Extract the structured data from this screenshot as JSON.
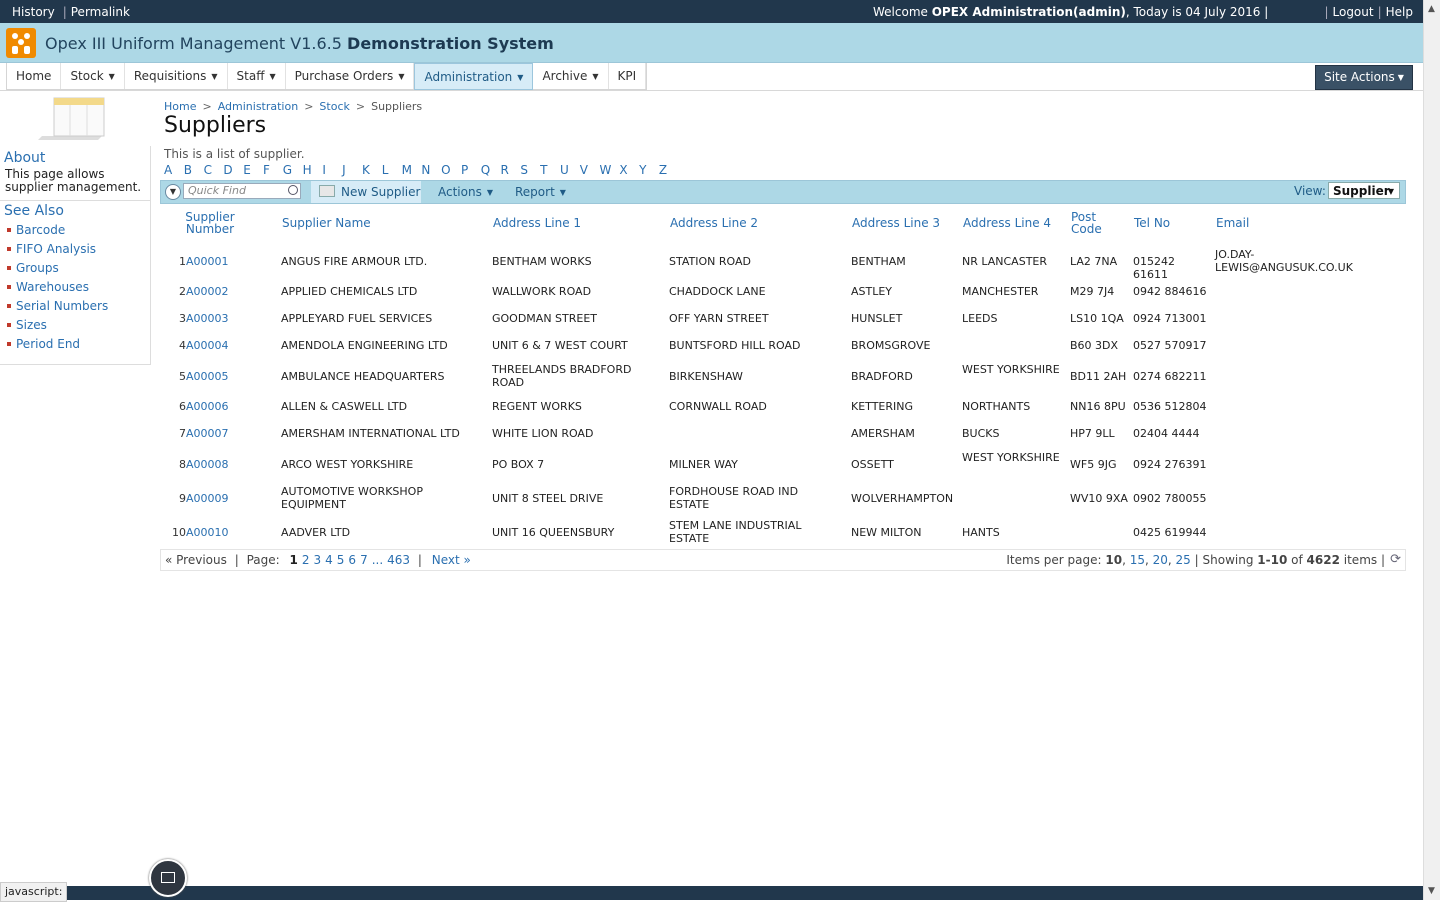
{
  "topbar": {
    "history": "History",
    "permalink": "Permalink",
    "welcome_prefix": "Welcome",
    "user": "OPEX Administration(admin)",
    "today": ", Today is 04 July 2016 |",
    "logout": "Logout",
    "help": "Help"
  },
  "site": {
    "title": "Opex III Uniform Management V1.6.5",
    "subtitle": "Demonstration System"
  },
  "nav": {
    "items": [
      "Home",
      "Stock",
      "Requisitions",
      "Staff",
      "Purchase Orders",
      "Administration",
      "Archive",
      "KPI"
    ],
    "site_actions": "Site Actions"
  },
  "left": {
    "about_title": "About",
    "about_text": "This page allows supplier management.",
    "see_also_title": "See Also",
    "links": [
      "Barcode",
      "FIFO Analysis",
      "Groups",
      "Warehouses",
      "Serial Numbers",
      "Sizes",
      "Period End"
    ]
  },
  "breadcrumb": [
    "Home",
    "Administration",
    "Stock",
    "Suppliers"
  ],
  "page": {
    "title": "Suppliers",
    "description": "This is a list of supplier."
  },
  "alphabet": [
    "A",
    "B",
    "C",
    "D",
    "E",
    "F",
    "G",
    "H",
    "I",
    "J",
    "K",
    "L",
    "M",
    "N",
    "O",
    "P",
    "Q",
    "R",
    "S",
    "T",
    "U",
    "V",
    "W",
    "X",
    "Y",
    "Z"
  ],
  "toolbar": {
    "quick_find_placeholder": "Quick Find",
    "new_supplier": "New Supplier",
    "actions": "Actions",
    "report": "Report",
    "view_label": "View:",
    "view_value": "Supplier"
  },
  "table": {
    "headers": [
      "Supplier Number",
      "Supplier Name",
      "Address Line 1",
      "Address Line 2",
      "Address Line 3",
      "Address Line 4",
      "Post Code",
      "Tel No",
      "Email"
    ],
    "rows": [
      [
        "1",
        "A00001",
        "ANGUS FIRE ARMOUR LTD.",
        "BENTHAM WORKS",
        "STATION ROAD",
        "BENTHAM",
        "NR LANCASTER",
        "LA2 7NA",
        "015242 61611",
        "JO.DAY-LEWIS@ANGUSUK.CO.UK"
      ],
      [
        "2",
        "A00002",
        "APPLIED CHEMICALS LTD",
        "WALLWORK ROAD",
        "CHADDOCK LANE",
        "ASTLEY",
        "MANCHESTER",
        "M29 7J4",
        "0942 884616",
        ""
      ],
      [
        "3",
        "A00003",
        "APPLEYARD FUEL SERVICES",
        "GOODMAN STREET",
        "OFF YARN STREET",
        "HUNSLET",
        "LEEDS",
        "LS10 1QA",
        "0924 713001",
        ""
      ],
      [
        "4",
        "A00004",
        "AMENDOLA ENGINEERING LTD",
        "UNIT 6 & 7 WEST COURT",
        "BUNTSFORD HILL ROAD",
        "BROMSGROVE",
        "",
        "B60 3DX",
        "0527 570917",
        ""
      ],
      [
        "5",
        "A00005",
        "AMBULANCE HEADQUARTERS",
        "THREELANDS BRADFORD ROAD",
        "BIRKENSHAW",
        "BRADFORD",
        "WEST YORKSHIRE",
        "BD11 2AH",
        "0274 682211",
        ""
      ],
      [
        "6",
        "A00006",
        "ALLEN & CASWELL LTD",
        "REGENT WORKS",
        "CORNWALL ROAD",
        "KETTERING",
        "NORTHANTS",
        "NN16 8PU",
        "0536 512804",
        ""
      ],
      [
        "7",
        "A00007",
        "AMERSHAM INTERNATIONAL LTD",
        "WHITE LION ROAD",
        "",
        "AMERSHAM",
        "BUCKS",
        "HP7 9LL",
        "02404 4444",
        ""
      ],
      [
        "8",
        "A00008",
        "ARCO WEST YORKSHIRE",
        "PO BOX 7",
        "MILNER WAY",
        "OSSETT",
        "WEST YORKSHIRE",
        "WF5 9JG",
        "0924 276391",
        ""
      ],
      [
        "9",
        "A00009",
        "AUTOMOTIVE WORKSHOP EQUIPMENT",
        "UNIT 8 STEEL DRIVE",
        "FORDHOUSE ROAD IND ESTATE",
        "WOLVERHAMPTON",
        "",
        "WV10 9XA",
        "0902 780055",
        ""
      ],
      [
        "10",
        "A00010",
        "AADVER LTD",
        "UNIT 16 QUEENSBURY",
        "STEM LANE INDUSTRIAL ESTATE",
        "NEW MILTON",
        "HANTS",
        "",
        "0425 619944",
        ""
      ]
    ]
  },
  "pager": {
    "previous": "« Previous",
    "page_label": "Page:",
    "pages": [
      "1",
      "2",
      "3",
      "4",
      "5",
      "6",
      "7",
      "...",
      "463"
    ],
    "next": "Next »",
    "items_per_page_label": "Items per page:",
    "per_page_options": [
      "10",
      "15",
      "20",
      "25"
    ],
    "showing_prefix": "Showing",
    "showing_range": "1-10",
    "of_label": "of",
    "total": "4622",
    "items_label": "items"
  },
  "status": {
    "text": "javascript:"
  },
  "colors": {
    "topbar": "#21374c",
    "titlebar": "#add8e6",
    "link": "#2a6fb0",
    "logo": "#f08a00"
  }
}
